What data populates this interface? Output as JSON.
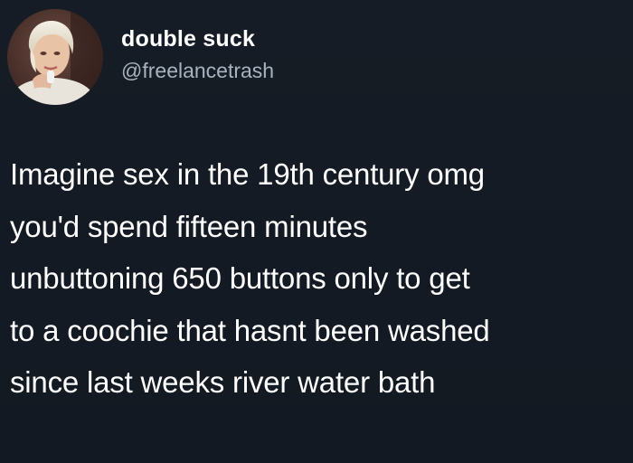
{
  "user": {
    "display_name": "double suck",
    "handle": "@freelancetrash",
    "avatar_icon": "profile-photo"
  },
  "tweet": {
    "lines": [
      "Imagine sex in the 19th century omg",
      "you'd spend fifteen minutes",
      "unbuttoning 650 buttons only to get",
      "to a coochie that hasnt been washed",
      "since last weeks river water bath"
    ]
  },
  "colors": {
    "background": "#141a23",
    "text": "#ffffff",
    "handle": "#a7b3bf"
  }
}
